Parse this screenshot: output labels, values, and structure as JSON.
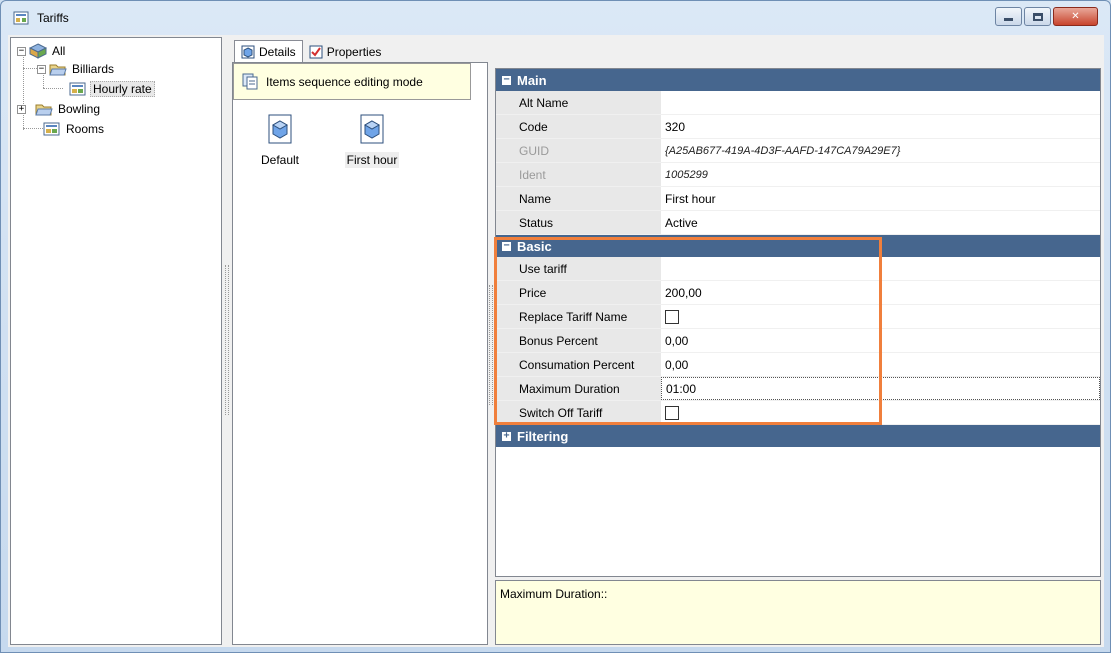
{
  "window": {
    "title": "Tariffs",
    "buttons": {
      "minimize": "—",
      "maximize": "▢",
      "close": "✕"
    }
  },
  "tree": {
    "items": [
      {
        "label": "All",
        "expander": "−",
        "icon": "root-icon"
      },
      {
        "label": "Billiards",
        "expander": "−",
        "icon": "folder-open-icon"
      },
      {
        "label": "Hourly rate",
        "icon": "tariff-icon",
        "selected": true
      },
      {
        "label": "Bowling",
        "expander": "+",
        "icon": "folder-open-icon"
      },
      {
        "label": "Rooms",
        "icon": "tariff-icon"
      }
    ]
  },
  "tabs": [
    {
      "label": "Details",
      "icon": "details-icon",
      "active": true
    },
    {
      "label": "Properties",
      "icon": "properties-icon",
      "active": false
    }
  ],
  "items_panel": {
    "mode_label": "Items sequence editing mode",
    "items": [
      {
        "label": "Default",
        "selected": false
      },
      {
        "label": "First hour",
        "selected": true
      }
    ]
  },
  "grid": {
    "categories": {
      "main": {
        "label": "Main",
        "sign": "−"
      },
      "basic": {
        "label": "Basic",
        "sign": "−"
      },
      "filtering": {
        "label": "Filtering",
        "sign": "+"
      }
    },
    "main_props": [
      {
        "name": "Alt Name",
        "value": ""
      },
      {
        "name": "Code",
        "value": "320"
      },
      {
        "name": "GUID",
        "value": "{A25AB677-419A-4D3F-AAFD-147CA79A29E7}",
        "disabled": true
      },
      {
        "name": "Ident",
        "value": "1005299",
        "disabled": true
      },
      {
        "name": "Name",
        "value": "First hour"
      },
      {
        "name": "Status",
        "value": "Active"
      }
    ],
    "basic_props": [
      {
        "name": "Use tariff",
        "value": ""
      },
      {
        "name": "Price",
        "value": "200,00"
      },
      {
        "name": "Replace Tariff Name",
        "checkbox": false
      },
      {
        "name": "Bonus Percent",
        "value": "0,00"
      },
      {
        "name": "Consumation Percent",
        "value": "0,00"
      },
      {
        "name": "Maximum Duration",
        "value": "01:00",
        "focused": true
      },
      {
        "name": "Switch Off Tariff",
        "checkbox": false
      }
    ]
  },
  "description": {
    "text": "Maximum Duration::"
  },
  "colors": {
    "category": "#46668e",
    "highlight": "#f07f3c",
    "tooltip": "#ffffe1"
  }
}
